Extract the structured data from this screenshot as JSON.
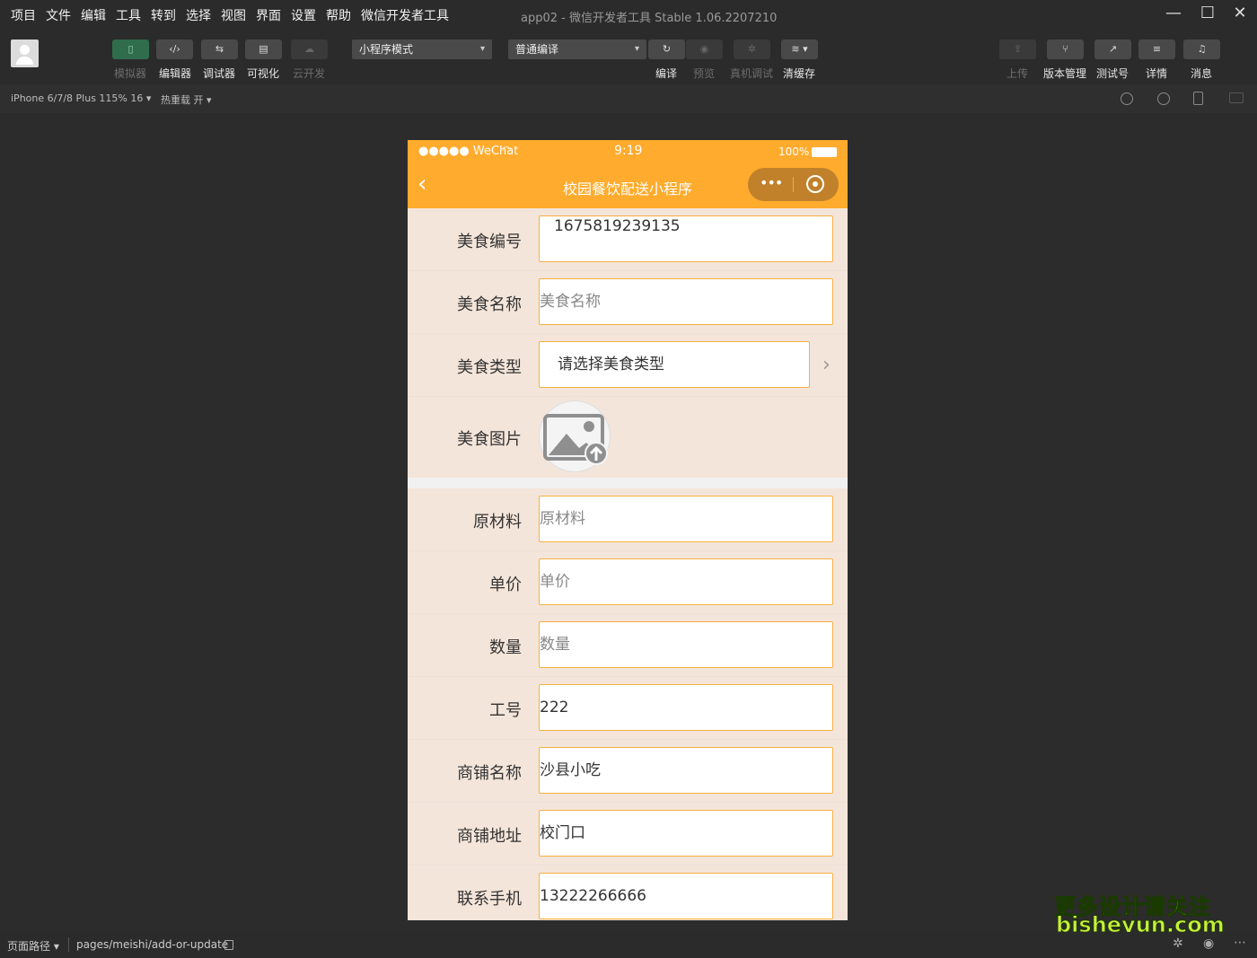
{
  "menu": [
    "项目",
    "文件",
    "编辑",
    "工具",
    "转到",
    "选择",
    "视图",
    "界面",
    "设置",
    "帮助",
    "微信开发者工具"
  ],
  "window_title": "app02 - 微信开发者工具 Stable 1.06.2207210",
  "toolbar": {
    "simulator": "模拟器",
    "editor": "编辑器",
    "debugger": "调试器",
    "visual": "可视化",
    "cloud": "云开发",
    "mode_select": "小程序模式",
    "compile_select": "普通编译",
    "compile": "编译",
    "preview": "预览",
    "device_debug": "真机调试",
    "clear_cache": "清缓存",
    "upload": "上传",
    "version": "版本管理",
    "test": "测试号",
    "details": "详情",
    "messages": "消息"
  },
  "subbar": {
    "device": "iPhone 6/7/8 Plus 115% 16 ▾",
    "hot_reload": "热重载 开 ▾"
  },
  "phone": {
    "carrier": "●●●●● WeChat",
    "time": "9:19",
    "battery": "100%",
    "title": "校园餐饮配送小程序",
    "fields": [
      {
        "label": "美食编号",
        "value": "1675819239135",
        "placeholder": false
      },
      {
        "label": "美食名称",
        "value": "美食名称",
        "placeholder": true
      },
      {
        "label": "美食类型",
        "value": "请选择美食类型",
        "placeholder": false
      },
      {
        "label": "美食图片",
        "value": "",
        "placeholder": false
      },
      {
        "label": "原材料",
        "value": "原材料",
        "placeholder": true
      },
      {
        "label": "单价",
        "value": "单价",
        "placeholder": true
      },
      {
        "label": "数量",
        "value": "数量",
        "placeholder": true
      },
      {
        "label": "工号",
        "value": "222",
        "placeholder": false
      },
      {
        "label": "商铺名称",
        "value": "沙县小吃",
        "placeholder": false
      },
      {
        "label": "商铺地址",
        "value": "校门口",
        "placeholder": false
      },
      {
        "label": "联系手机",
        "value": "13222266666",
        "placeholder": false
      }
    ]
  },
  "bottombar": {
    "page_path_label": "页面路径 ▾",
    "page_path": "pages/meishi/add-or-update"
  },
  "watermark": {
    "line1": "更多设计请关注",
    "line2": "bisheyun.com"
  },
  "colors": {
    "accent": "#ffab2d",
    "input_border": "#f5b042",
    "phone_bg": "#f4e5da"
  }
}
